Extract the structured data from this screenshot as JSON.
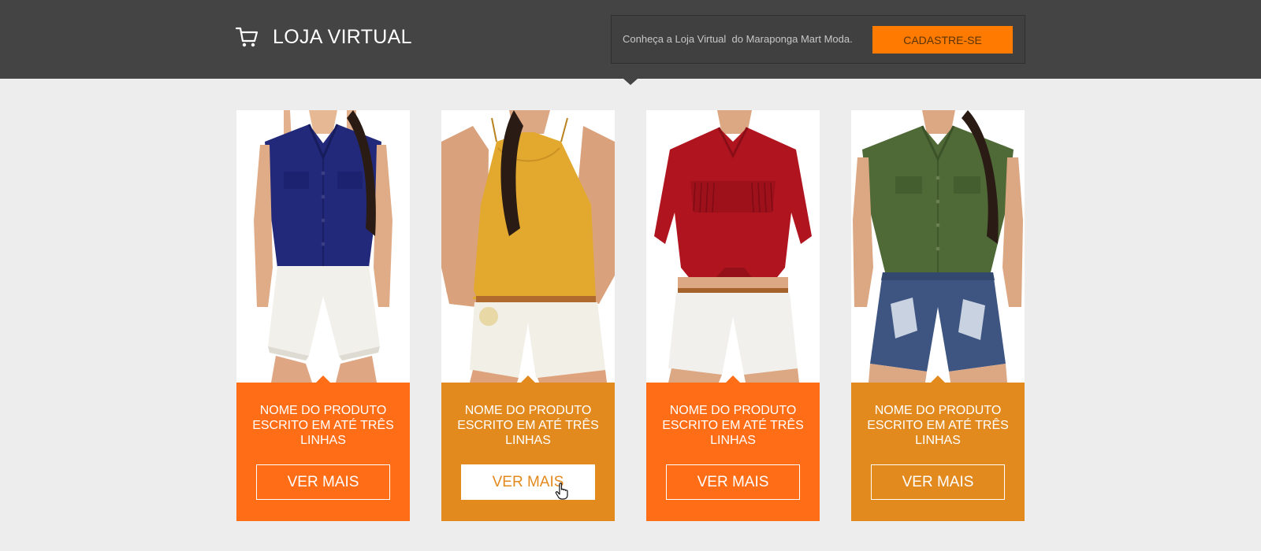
{
  "header": {
    "logo_text": "LOJA VIRTUAL",
    "logo_icon": "shopping-cart-icon",
    "promo_text": "Conheça a Loja Virtual  do Maraponga Mart Moda.",
    "cta_label": "CADASTRE-SE",
    "colors": {
      "bar": "#444444",
      "cta": "#ff7a00"
    }
  },
  "products": [
    {
      "name": "NOME DO PRODUTO ESCRITO EM ATÉ TRÊS LINHAS",
      "button_label": "VER MAIS",
      "panel_color": "#ff6d16",
      "garment": "navy sleeveless button shirt with white shorts"
    },
    {
      "name": "NOME DO PRODUTO ESCRITO EM ATÉ TRÊS LINHAS",
      "button_label": "VER MAIS",
      "panel_color": "#e38a1e",
      "garment": "mustard strappy top with white shorts"
    },
    {
      "name": "NOME DO PRODUTO ESCRITO EM ATÉ TRÊS LINHAS",
      "button_label": "VER MAIS",
      "panel_color": "#ff6d16",
      "garment": "red fringed tied shirt with white shorts"
    },
    {
      "name": "NOME DO PRODUTO ESCRITO EM ATÉ TRÊS LINHAS",
      "button_label": "VER MAIS",
      "panel_color": "#e38a1e",
      "garment": "olive sleeveless shirt with denim shorts"
    }
  ]
}
